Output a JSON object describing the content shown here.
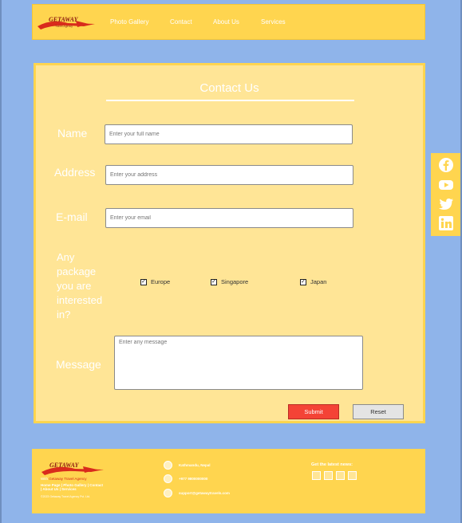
{
  "brand": {
    "logo_text": "GETAWAY",
    "logo_tagline": "Travel Agency",
    "full_name": "Getaway Travel Agency",
    "accent": "#ffd54f",
    "page_bg": "#8fb4ea"
  },
  "nav": {
    "items": [
      {
        "label": "Photo Gallery"
      },
      {
        "label": "Contact"
      },
      {
        "label": "About Us"
      },
      {
        "label": "Services"
      }
    ]
  },
  "social": {
    "icons": [
      "facebook-icon",
      "youtube-icon",
      "twitter-icon",
      "linkedin-icon"
    ]
  },
  "contact": {
    "title": "Contact Us",
    "name_label": "Name",
    "name_placeholder": "Enter your full name",
    "address_label": "Address",
    "address_placeholder": "Enter your address",
    "email_label": "E-mail",
    "email_placeholder": "Enter your email",
    "package_label": "Any package you are interested in?",
    "packages": [
      {
        "label": "Europe",
        "checked": true
      },
      {
        "label": "Singapore",
        "checked": true
      },
      {
        "label": "Japan",
        "checked": true
      }
    ],
    "message_label": "Message",
    "message_placeholder": "Enter any message",
    "submit_label": "Submit",
    "reset_label": "Reset",
    "submit_color": "#f44336"
  },
  "footer": {
    "logo_text": "GETAWAY",
    "brand_line_prefix": "With",
    "brand_line": "Getaway Travel Agency",
    "links": "Home Page | Photo Gallery | Contact | About Us | Services",
    "copyright": "©2023 Getaway Travel Agency Pvt. Ltd.",
    "location": "Kathmandu, Nepal",
    "phone": "+977 9800000000",
    "email": "support@getawaytravels.com",
    "news_label": "Get the latest news:"
  }
}
